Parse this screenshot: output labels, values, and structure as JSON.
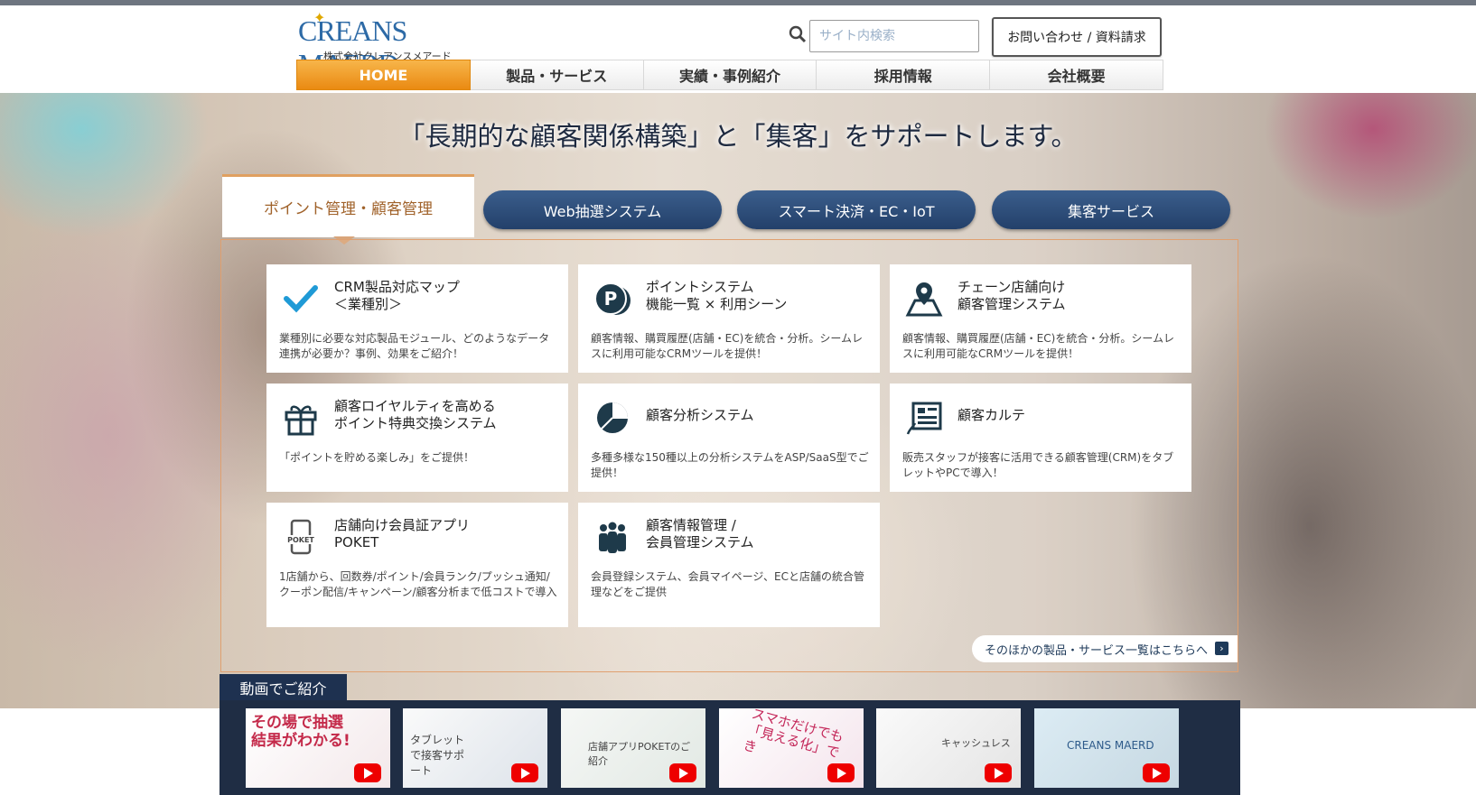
{
  "header": {
    "logo_text": "CREANS MAERD",
    "logo_sub": "株式会社クレアンスメアード",
    "search_placeholder": "サイト内検索",
    "contact_label": "お問い合わせ / 資料請求"
  },
  "nav": [
    "HOME",
    "製品・サービス",
    "実績・事例紹介",
    "採用情報",
    "会社概要"
  ],
  "hero": {
    "title": "「長期的な顧客関係構築」と「集客」をサポートします。"
  },
  "tabs": {
    "active": "ポイント管理・顧客管理",
    "others": [
      "Web抽選システム",
      "スマート決済・EC・IoT",
      "集客サービス"
    ]
  },
  "cards": [
    {
      "title": "CRM製品対応マップ\n＜業種別＞",
      "desc": "業種別に必要な対応製品モジュール、どのようなデータ連携が必要か？事例、効果をご紹介！",
      "icon": "check-icon"
    },
    {
      "title": "ポイントシステム\n機能一覧 × 利用シーン",
      "desc": "顧客情報、購買履歴(店舗・EC)を統合・分析。シームレスに利用可能なCRMツールを提供！",
      "icon": "point-coin-icon"
    },
    {
      "title": "チェーン店舗向け\n顧客管理システム",
      "desc": "顧客情報、購買履歴(店舗・EC)を統合・分析。シームレスに利用可能なCRMツールを提供！",
      "icon": "map-pin-icon"
    },
    {
      "title": "顧客ロイヤルティを高める\nポイント特典交換システム",
      "desc": "「ポイントを貯める楽しみ」をご提供！",
      "icon": "gift-icon"
    },
    {
      "title": "顧客分析システム",
      "desc": "多種多様な150種以上の分析システムをASP/SaaS型でご提供！",
      "icon": "pie-chart-icon"
    },
    {
      "title": "顧客カルテ",
      "desc": "販売スタッフが接客に活用できる顧客管理(CRM)をタブレットやPCで導入！",
      "icon": "tablet-icon"
    },
    {
      "title": "店舗向け会員証アプリ\nPOKET",
      "desc": "1店舗から、回数券/ポイント/会員ランク/プッシュ通知/クーポン配信/キャンペーン/顧客分析まで低コストで導入",
      "icon": "poket-app-icon"
    },
    {
      "title": "顧客情報管理 /\n会員管理システム",
      "desc": "会員登録システム、会員マイページ、ECと店舗の統合管理などをご提供",
      "icon": "people-icon"
    }
  ],
  "more_link": "そのほかの製品・サービス一覧はこちらへ",
  "video": {
    "label": "動画でご紹介",
    "thumbs": [
      {
        "text": "その場で抽選結果がわかる!"
      },
      {
        "text": "タブレットで接客サポート"
      },
      {
        "text": "店舗アプリPOKETのご紹介"
      },
      {
        "text": "スマホだけでも「見える化」でき"
      },
      {
        "text": "キャッシュレス"
      },
      {
        "text": "CREANS MAERD"
      }
    ]
  }
}
